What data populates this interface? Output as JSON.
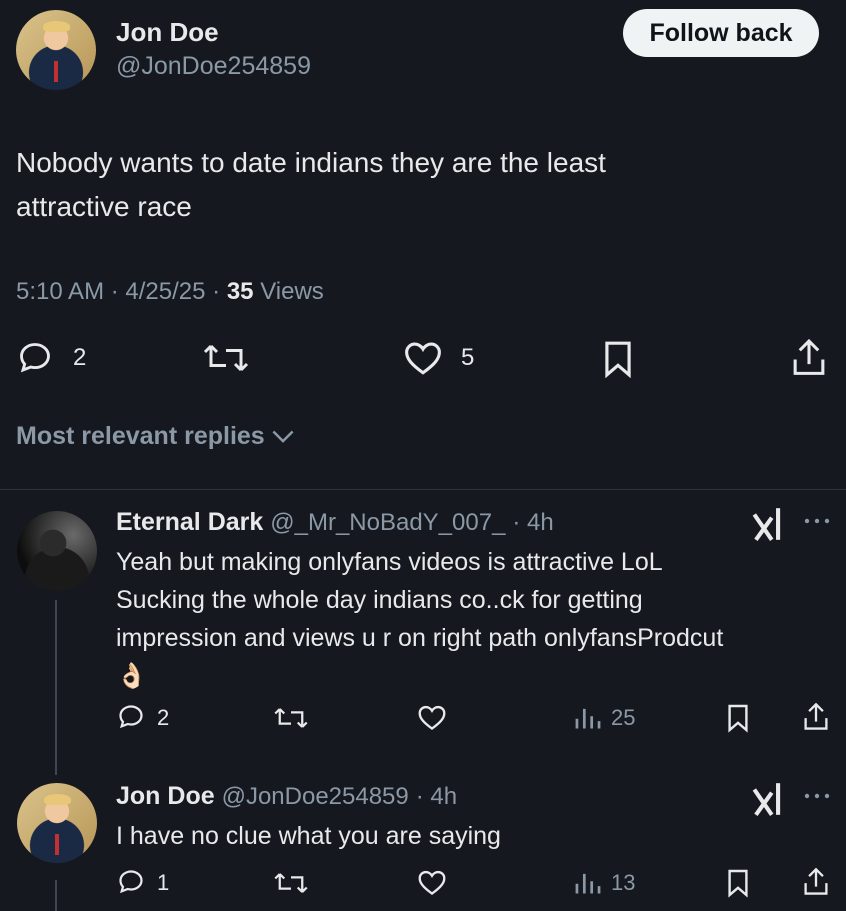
{
  "tweet": {
    "author_name": "Jon Doe",
    "author_handle": "@JonDoe254859",
    "follow_label": "Follow back",
    "text_line1": "Nobody wants to date indians they are the least",
    "text_line2": "attractive race",
    "time": "5:10 AM",
    "sep1": "·",
    "date": "4/25/25",
    "sep2": "·",
    "views_count": "35",
    "views_label": "Views",
    "replies_count": "2",
    "likes_count": "5"
  },
  "replies_header": {
    "label": "Most relevant replies"
  },
  "replies": [
    {
      "author_name": "Eternal Dark",
      "author_handle": "@_Mr_NoBadY_007_",
      "meta": "· 4h",
      "line1": "Yeah but making onlyfans videos is attractive LoL",
      "line2": "Sucking the whole day indians co..ck for getting",
      "line3": "impression and views u r on right path onlyfansProdcut",
      "emoji": "👌🏻",
      "replies_count": "2",
      "views_count": "25"
    },
    {
      "author_name": "Jon Doe",
      "author_handle": "@JonDoe254859",
      "meta": "· 4h",
      "line1": "I have no clue what you are saying",
      "replies_count": "1",
      "views_count": "13"
    }
  ],
  "icons": {
    "reply": "reply-icon",
    "retweet": "retweet-icon",
    "like": "heart-icon",
    "bookmark": "bookmark-icon",
    "share": "share-icon",
    "views": "views-chart-icon",
    "grok": "grok-icon",
    "more": "more-icon",
    "chevron": "chevron-down-icon"
  }
}
